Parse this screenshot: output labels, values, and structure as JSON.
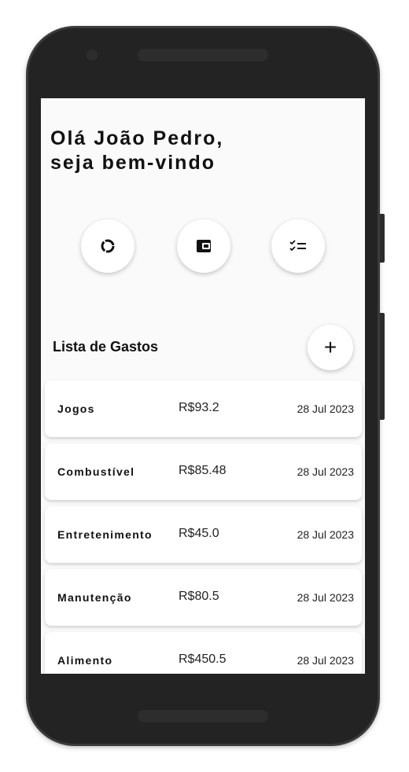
{
  "greeting": {
    "line1": "Olá João Pedro,",
    "line2": "seja bem-vindo"
  },
  "actions": [
    {
      "icon": "donut-chart-icon"
    },
    {
      "icon": "wallet-icon"
    },
    {
      "icon": "checklist-icon"
    }
  ],
  "expenses": {
    "title": "Lista de Gastos",
    "add_label": "+",
    "items": [
      {
        "name": "Jogos",
        "amount": "R$93.2",
        "date": "28 Jul 2023"
      },
      {
        "name": "Combustível",
        "amount": "R$85.48",
        "date": "28 Jul 2023"
      },
      {
        "name": "Entretenimento",
        "amount": "R$45.0",
        "date": "28 Jul 2023"
      },
      {
        "name": "Manutenção",
        "amount": "R$80.5",
        "date": "28 Jul 2023"
      },
      {
        "name": "Alimento",
        "amount": "R$450.5",
        "date": "28 Jul 2023"
      }
    ]
  }
}
